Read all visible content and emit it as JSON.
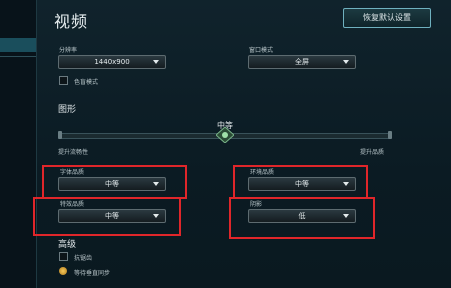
{
  "title": "视频",
  "reset_button": "恢复默认设置",
  "resolution": {
    "label": "分辨率",
    "value": "1440x900"
  },
  "window_mode": {
    "label": "窗口模式",
    "value": "全屏"
  },
  "colorblind": {
    "label": "色盲模式",
    "checked": false
  },
  "graphics": {
    "title": "图形",
    "quality_value": "中等",
    "slider_level": 0.5,
    "left_hint": "提升流畅性",
    "right_hint": "提升品质"
  },
  "character_quality": {
    "label": "字体品质",
    "value": "中等"
  },
  "environment_quality": {
    "label": "环境品质",
    "value": "中等"
  },
  "effects_quality": {
    "label": "特效品质",
    "value": "中等"
  },
  "shadows": {
    "label": "阴影",
    "value": "低"
  },
  "advanced": {
    "title": "高级",
    "antialias": {
      "label": "抗锯齿",
      "checked": false
    },
    "vsync": {
      "label": "等待垂直同步",
      "checked": true
    }
  },
  "colors": {
    "accent": "#5fc6d8",
    "highlight": "#e0262a"
  }
}
